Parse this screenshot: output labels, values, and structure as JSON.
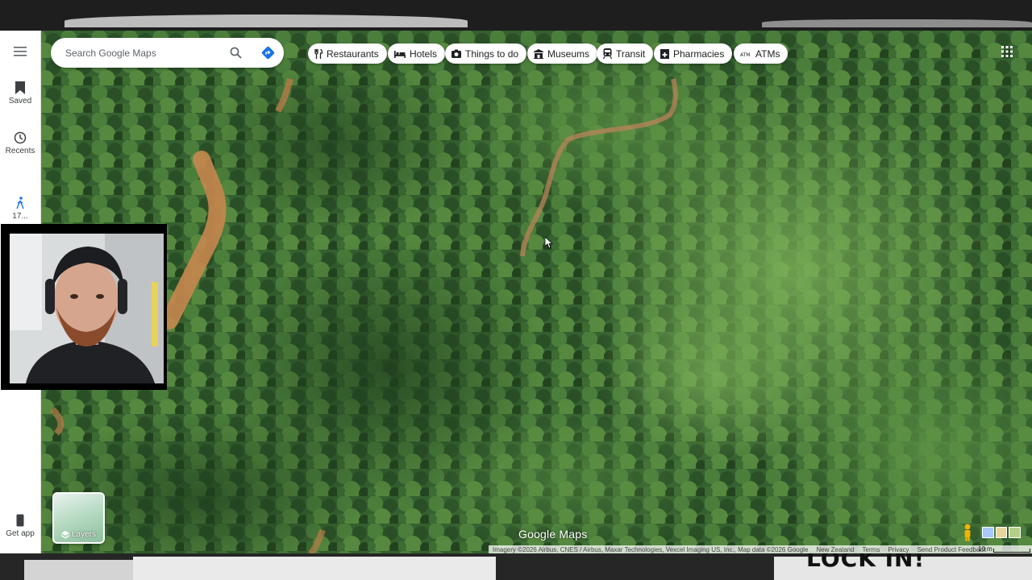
{
  "sidebar": {
    "menu_icon": "hamburger-menu-icon",
    "items": [
      {
        "label": "Saved",
        "icon": "bookmark-icon"
      },
      {
        "label": "Recents",
        "icon": "history-icon"
      },
      {
        "label": "17...",
        "icon": "walking-person-icon"
      }
    ],
    "get_app_label": "Get app"
  },
  "search": {
    "placeholder": "Search Google Maps",
    "value": ""
  },
  "chips": [
    {
      "label": "Restaurants",
      "icon": "fork-knife-icon"
    },
    {
      "label": "Hotels",
      "icon": "bed-icon"
    },
    {
      "label": "Things to do",
      "icon": "camera-icon"
    },
    {
      "label": "Museums",
      "icon": "museum-icon"
    },
    {
      "label": "Transit",
      "icon": "train-icon"
    },
    {
      "label": "Pharmacies",
      "icon": "pharmacy-icon"
    },
    {
      "label": "ATMs",
      "icon": "atm-icon"
    }
  ],
  "layers": {
    "label": "Layers"
  },
  "logo": {
    "text": "Google Maps"
  },
  "attribution": {
    "imagery": "Imagery ©2026 Airbus, CNES / Airbus, Maxar Technologies, Vexcel Imaging US, Inc., Map data ©2026 Google",
    "country": "New Zealand",
    "terms": "Terms",
    "privacy": "Privacy",
    "feedback": "Send Product Feedback",
    "scale": "10 m"
  },
  "overlay": {
    "caption": "LOCK IN!"
  },
  "colors": {
    "accent": "#1a73e8",
    "forest_dark": "#2b4f28",
    "forest_light": "#6aa04f",
    "dirt_road": "#c7874f"
  }
}
